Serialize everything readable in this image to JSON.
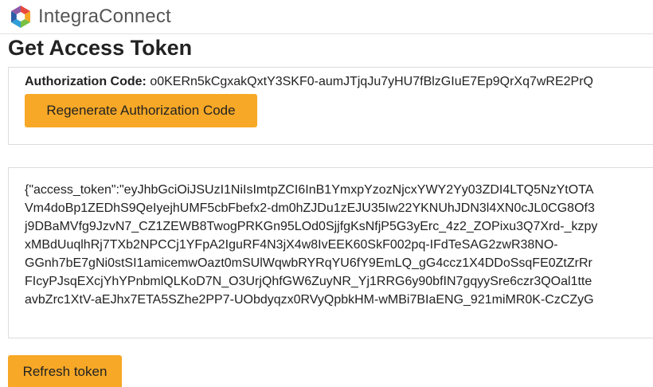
{
  "header": {
    "brand_name": "IntegraConnect",
    "logo": "integraconnect-hexagon-logo",
    "brand_colors": [
      "#e8473c",
      "#f5a623",
      "#7ac143",
      "#2f9fd8",
      "#2b5ea7",
      "#8e5aa8"
    ]
  },
  "page": {
    "title": "Get Access Token"
  },
  "auth": {
    "label": "Authorization Code:",
    "value": "o0KERn5kCgxakQxtY3SKF0-aumJTjqJu7yHU7fBlzGIuE7Ep9QrXq7wRE2PrQ",
    "regenerate_label": "Regenerate Authorization Code"
  },
  "token": {
    "lines": [
      "{\"access_token\":\"eyJhbGciOiJSUzI1NiIsImtpZCI6InB1YmxpYzozNjcxYWY2Yy03ZDI4LTQ5NzYtOTA",
      "Vm4doBp1ZEDhS9QeIyejhUMF5cbFbefx2-dm0hZJDu1zEJU35Iw22YKNUhJDN3l4XN0cJL0CG8Of3",
      "j9DBaMVfg9JzvN7_CZ1ZEWB8TwogPRKGn95LOd0SjjfgKsNfjP5G3yErc_4z2_ZOPixu3Q7Xrd-_kzpy",
      "xMBdUuqlhRj7TXb2NPCCj1YFpA2IguRF4N3jX4w8IvEEK60SkF002pq-IFdTeSAG2zwR38NO-",
      "GGnh7bE7gNi0stSI1amicemwOazt0mSUlWqwbRYRqYU6fY9EmLQ_gG4ccz1X4DDoSsqFE0ZtZrRr",
      "FIcyPJsqEXcjYhYPnbmlQLKoD7N_O3UrjQhfGW6ZuyNR_Yj1RRG6y90bfIN7gqyySre6czr3QOal1tte",
      "avbZrc1XtV-aEJhx7ETA5SZhe2PP7-UObdyqzx0RVyQpbkHM-wMBi7BIaENG_921miMR0K-CzCZyG"
    ]
  },
  "actions": {
    "refresh_label": "Refresh token"
  },
  "colors": {
    "accent_button": "#f7a826",
    "panel_border": "#dcdcdc"
  }
}
